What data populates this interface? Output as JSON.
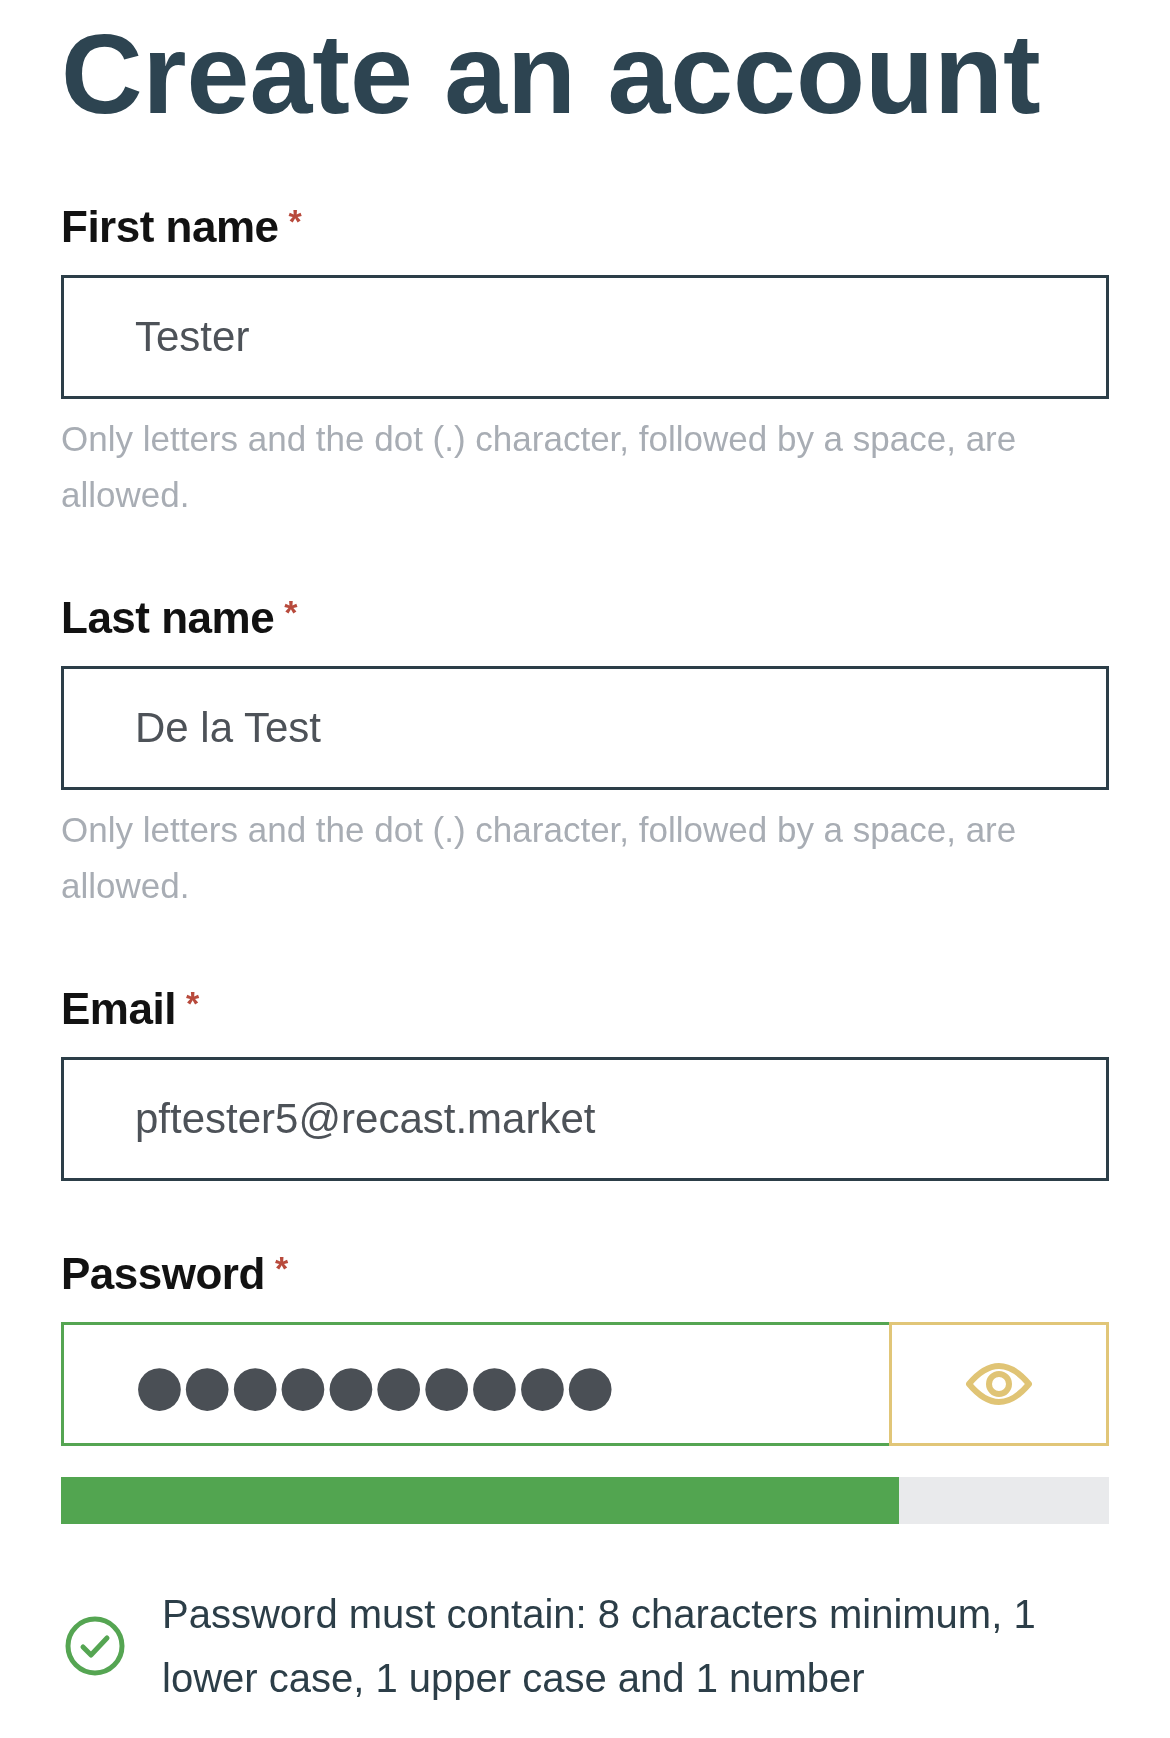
{
  "title": "Create an account",
  "fields": [
    {
      "kind": "text",
      "label": "First name",
      "required_mark": "*",
      "value": "Tester",
      "hint": "Only letters and the dot (.) character, followed by a space, are allowed."
    },
    {
      "kind": "text",
      "label": "Last name",
      "required_mark": "*",
      "value": "De la Test",
      "hint": "Only letters and the dot (.) character, followed by a space, are allowed."
    },
    {
      "kind": "text",
      "label": "Email",
      "required_mark": "*",
      "value": "pftester5@recast.market"
    },
    {
      "kind": "password",
      "label": "Password",
      "required_mark": "*",
      "value": "●●●●●●●●●●",
      "valid": true
    }
  ],
  "strength_meter": {
    "level": 0.8
  },
  "requirement": {
    "met": true,
    "text": "Password must contain: 8 characters minimum, 1 lower case, 1 upper case and 1 number"
  }
}
